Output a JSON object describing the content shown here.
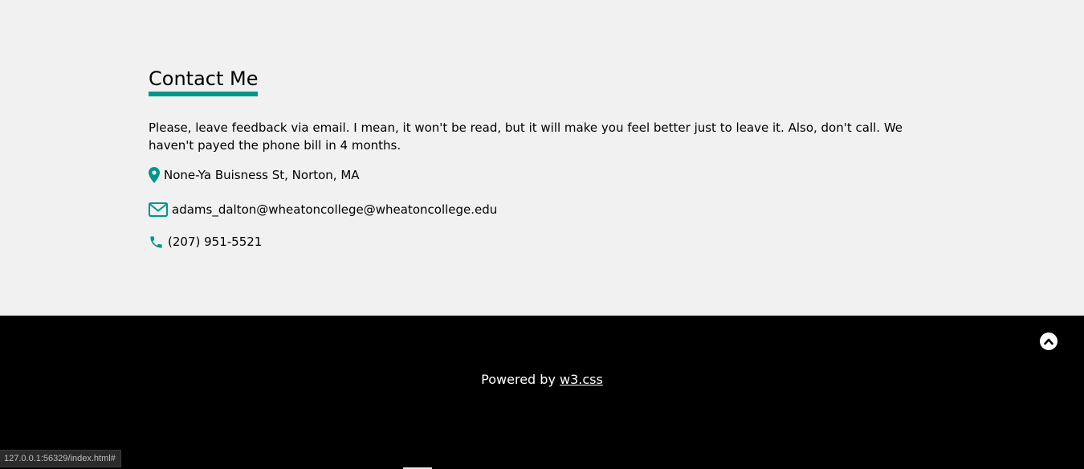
{
  "contact": {
    "title": "Contact Me",
    "intro": "Please, leave feedback via email. I mean, it won't be read, but it will make you feel better just to leave it. Also, don't call. We haven't payed the phone bill in 4 months.",
    "items": [
      {
        "icon": "map-marker-icon",
        "text": "None-Ya Buisness St, Norton, MA"
      },
      {
        "icon": "envelope-icon",
        "text": "adams_dalton@wheatoncollege@wheatoncollege.edu"
      },
      {
        "icon": "phone-icon",
        "text": "(207) 951-5521"
      }
    ],
    "accent_color": "#009688"
  },
  "footer": {
    "powered_prefix": "Powered by ",
    "powered_link": "w3.css",
    "to_top_icon": "chevron-up-circle-icon",
    "background": "#000000"
  },
  "status_bar": {
    "url": "127.0.0.1:56329/index.html#"
  }
}
